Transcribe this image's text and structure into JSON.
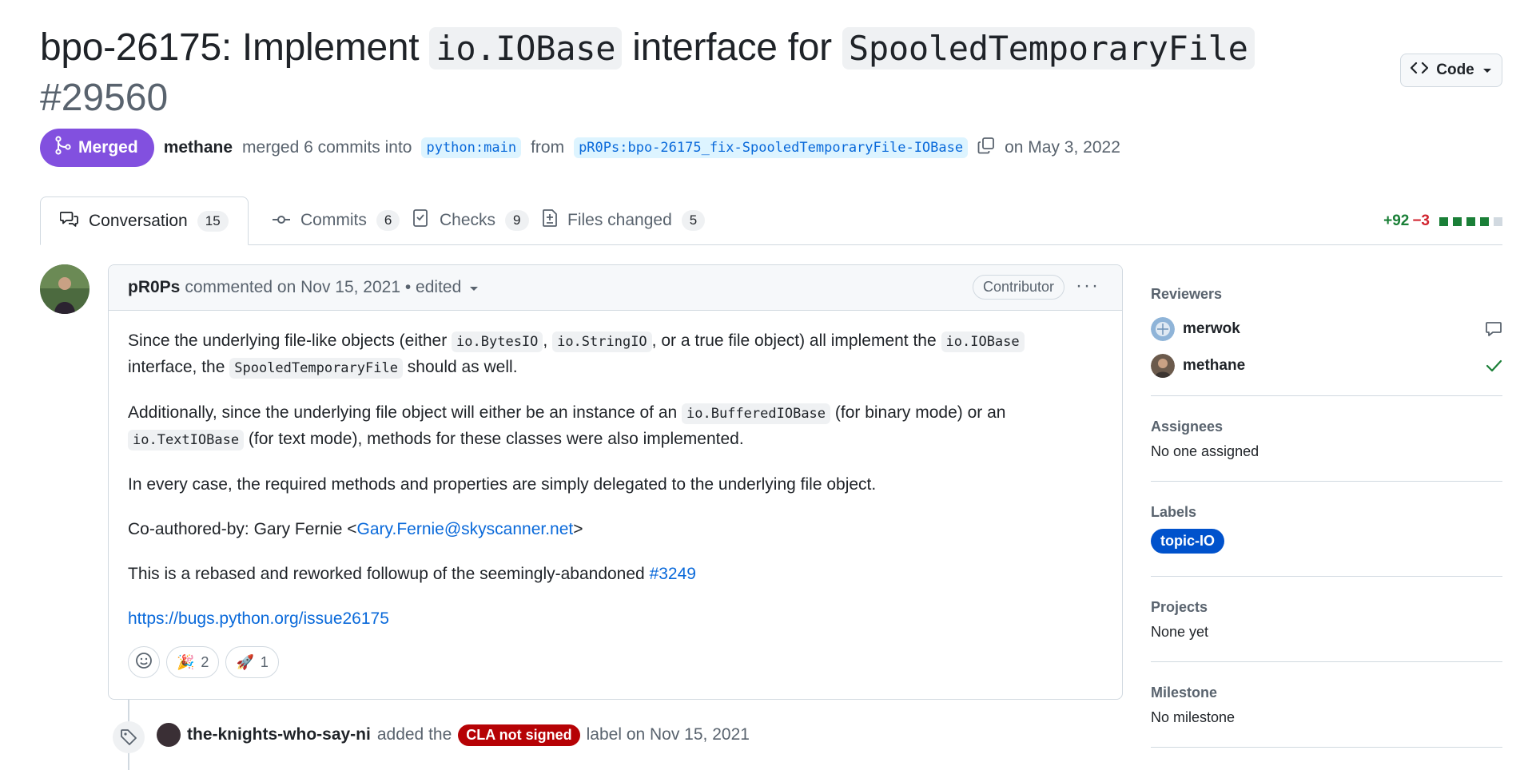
{
  "pr": {
    "title_part1": "bpo-26175: Implement ",
    "title_code1": "io.IOBase",
    "title_part2": " interface for ",
    "title_code2": "SpooledTemporaryFile",
    "number": "#29560",
    "state": "Merged",
    "merger": "methane",
    "merge_text": "merged 6 commits into",
    "base_branch": "python:main",
    "from_text": "from",
    "head_branch": "pR0Ps:bpo-26175_fix-SpooledTemporaryFile-IOBase",
    "date_text": "on May 3, 2022"
  },
  "code_button": {
    "label": "Code"
  },
  "tabs": [
    {
      "label": "Conversation",
      "count": "15",
      "icon": "comment-discussion-icon"
    },
    {
      "label": "Commits",
      "count": "6",
      "icon": "git-commit-icon"
    },
    {
      "label": "Checks",
      "count": "9",
      "icon": "checklist-icon"
    },
    {
      "label": "Files changed",
      "count": "5",
      "icon": "file-diff-icon"
    }
  ],
  "diffstat": {
    "additions": "+92",
    "deletions": "−3",
    "colors": [
      "#1a7f37",
      "#1a7f37",
      "#1a7f37",
      "#1a7f37",
      "#d1d9e0"
    ]
  },
  "comment": {
    "author": "pR0Ps",
    "meta": "commented on Nov 15, 2021 • edited",
    "role": "Contributor",
    "p1_a": "Since the underlying file-like objects (either ",
    "p1_c1": "io.BytesIO",
    "p1_b": ", ",
    "p1_c2": "io.StringIO",
    "p1_c": ", or a true file object) all implement the ",
    "p1_c3": "io.IOBase",
    "p1_d": "interface, the ",
    "p1_c4": "SpooledTemporaryFile",
    "p1_e": " should as well.",
    "p2_a": "Additionally, since the underlying file object will either be an instance of an ",
    "p2_c1": "io.BufferedIOBase",
    "p2_b": " (for binary mode) or an",
    "p2_c2": "io.TextIOBase",
    "p2_c": " (for text mode), methods for these classes were also implemented.",
    "p3": "In every case, the required methods and properties are simply delegated to the underlying file object.",
    "p4_a": "Co-authored-by: Gary Fernie <",
    "p4_link": "Gary.Fernie@skyscanner.net",
    "p4_b": ">",
    "p5_a": "This is a rebased and reworked followup of the seemingly-abandoned ",
    "p5_link": "#3249",
    "p6_link": "https://bugs.python.org/issue26175",
    "reactions": [
      {
        "emoji": "🎉",
        "count": "2"
      },
      {
        "emoji": "🚀",
        "count": "1"
      }
    ]
  },
  "timeline": {
    "actor": "the-knights-who-say-ni",
    "action": "added the",
    "label": "CLA not signed",
    "label_color": "#b60205",
    "suffix": "label on Nov 15, 2021"
  },
  "sidebar": {
    "reviewers_title": "Reviewers",
    "reviewers": [
      {
        "name": "merwok",
        "status": "comment-icon"
      },
      {
        "name": "methane",
        "status": "check-icon"
      }
    ],
    "assignees_title": "Assignees",
    "assignees_value": "No one assigned",
    "labels_title": "Labels",
    "labels": [
      {
        "name": "topic-IO",
        "color": "#0052cc"
      }
    ],
    "projects_title": "Projects",
    "projects_value": "None yet",
    "milestone_title": "Milestone",
    "milestone_value": "No milestone"
  }
}
